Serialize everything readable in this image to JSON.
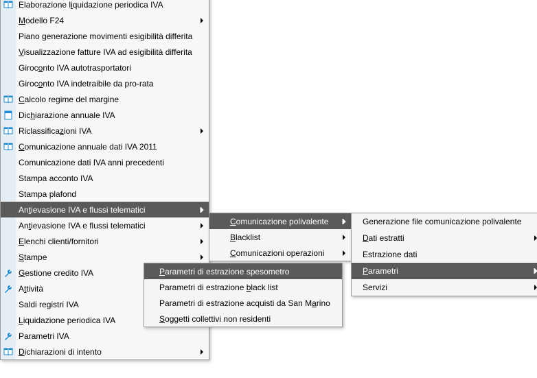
{
  "main": {
    "items": [
      {
        "label": "Elaborazione liquidazione periodica IVA",
        "u": 14,
        "icon": "book",
        "arrow": false
      },
      {
        "label": "Modello F24",
        "u": 0,
        "icon": "",
        "arrow": true
      },
      {
        "label": "Piano generazione movimenti esigibilità differita",
        "u": -1,
        "icon": "",
        "arrow": false
      },
      {
        "label": "Visualizzazione fatture IVA ad esigibilità differita",
        "u": 0,
        "icon": "",
        "arrow": false
      },
      {
        "label": "Giroconto IVA autotrasportatori",
        "u": 5,
        "icon": "",
        "arrow": false
      },
      {
        "label": "Giroconto IVA indetraibile da pro-rata",
        "u": 5,
        "icon": "",
        "arrow": false
      },
      {
        "label": "Calcolo regime del margine",
        "u": 0,
        "icon": "book",
        "arrow": false
      },
      {
        "label": "Dichiarazione annuale IVA",
        "u": 3,
        "icon": "doc",
        "arrow": false
      },
      {
        "label": "Riclassificazioni IVA",
        "u": 12,
        "icon": "book",
        "arrow": true
      },
      {
        "label": "Comunicazione annuale dati IVA 2011",
        "u": 0,
        "icon": "book",
        "arrow": false
      },
      {
        "label": "Comunicazione dati IVA anni precedenti",
        "u": -1,
        "icon": "",
        "arrow": false
      },
      {
        "label": "Stampa acconto IVA",
        "u": -1,
        "icon": "",
        "arrow": false
      },
      {
        "label": "Stampa plafond",
        "u": -1,
        "icon": "",
        "arrow": false
      },
      {
        "label": "Antievasione IVA e flussi telematici",
        "u": 2,
        "icon": "",
        "arrow": true,
        "hl": true
      },
      {
        "label": "Antievasione IVA e flussi telematici",
        "u": 2,
        "icon": "",
        "arrow": true
      },
      {
        "label": "Elenchi clienti/fornitori",
        "u": 0,
        "icon": "",
        "arrow": true
      },
      {
        "label": "Stampe",
        "u": 0,
        "icon": "",
        "arrow": true
      },
      {
        "label": "Gestione credito IVA",
        "u": 0,
        "icon": "wrench",
        "arrow": false
      },
      {
        "label": "Attività",
        "u": 1,
        "icon": "wrench",
        "arrow": false
      },
      {
        "label": "Saldi registri IVA",
        "u": -1,
        "icon": "",
        "arrow": false
      },
      {
        "label": "Liquidazione periodica IVA",
        "u": 0,
        "icon": "",
        "arrow": false
      },
      {
        "label": "Parametri IVA",
        "u": -1,
        "icon": "wrench",
        "arrow": false
      },
      {
        "label": "Dichiarazioni di intento",
        "u": 0,
        "icon": "book",
        "arrow": true
      }
    ]
  },
  "sub1": {
    "items": [
      {
        "label": "Comunicazione polivalente",
        "u": 0,
        "arrow": true,
        "hl": true
      },
      {
        "label": "Blacklist",
        "u": 0,
        "arrow": true
      },
      {
        "label": "Comunicazioni operazioni",
        "u": 0,
        "arrow": true
      }
    ]
  },
  "sub2": {
    "items": [
      {
        "label": "Parametri di estrazione spesometro",
        "u": 0,
        "hl": true
      },
      {
        "label": "Parametri di estrazione black list",
        "u": 24
      },
      {
        "label": "Parametri di estrazione acquisti da San Marino",
        "u": 41
      },
      {
        "label": "Soggetti collettivi non residenti",
        "u": 0
      }
    ]
  },
  "sub3": {
    "items": [
      {
        "label": "Generazione file comunicazione polivalente",
        "u": -1,
        "arrow": false
      },
      {
        "label": "Dati estratti",
        "u": 0,
        "arrow": true
      },
      {
        "label": "Estrazione dati",
        "u": -1,
        "arrow": false
      },
      {
        "label": "Parametri",
        "u": 0,
        "arrow": true,
        "hl": true
      },
      {
        "label": "Servizi",
        "u": -1,
        "arrow": true
      }
    ]
  }
}
